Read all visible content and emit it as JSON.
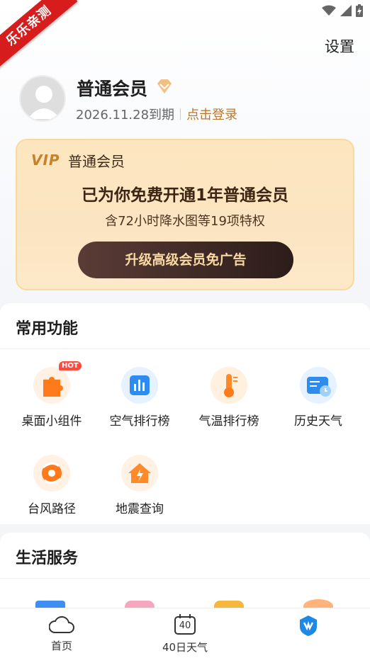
{
  "status": {
    "icons": [
      "wifi-icon",
      "signal-icon",
      "battery-charging-icon"
    ]
  },
  "ribbon": {
    "text": "乐乐亲测"
  },
  "header": {
    "settings_label": "设置"
  },
  "profile": {
    "name": "普通会员",
    "expire": "2026.11.28到期",
    "login": "点击登录"
  },
  "vip_card": {
    "logo": "VIP",
    "title": "普通会员",
    "headline": "已为你免费开通1年普通会员",
    "sub": "含72小时降水图等19项特权",
    "button": "升级高级会员免广告"
  },
  "common": {
    "title": "常用功能",
    "items": [
      {
        "label": "桌面小组件",
        "icon": "puzzle-icon",
        "badge": "HOT"
      },
      {
        "label": "空气排行榜",
        "icon": "bar-chart-icon"
      },
      {
        "label": "气温排行榜",
        "icon": "thermometer-icon"
      },
      {
        "label": "历史天气",
        "icon": "history-calendar-icon"
      },
      {
        "label": "台风路径",
        "icon": "typhoon-icon"
      },
      {
        "label": "地震查询",
        "icon": "earthquake-house-icon"
      }
    ]
  },
  "life": {
    "title": "生活服务"
  },
  "tabbar": {
    "items": [
      {
        "label": "首页",
        "icon": "cloud-icon"
      },
      {
        "label": "40日天气",
        "icon": "calendar-40-icon",
        "badge_number": "40"
      },
      {
        "label": "",
        "icon": "profile-shield-icon"
      }
    ]
  },
  "colors": {
    "accent_gold": "#c5822a",
    "hot_red": "#ff4a3d",
    "vip_button": "#2c1c1a",
    "active_tab": "#1e88e5"
  }
}
